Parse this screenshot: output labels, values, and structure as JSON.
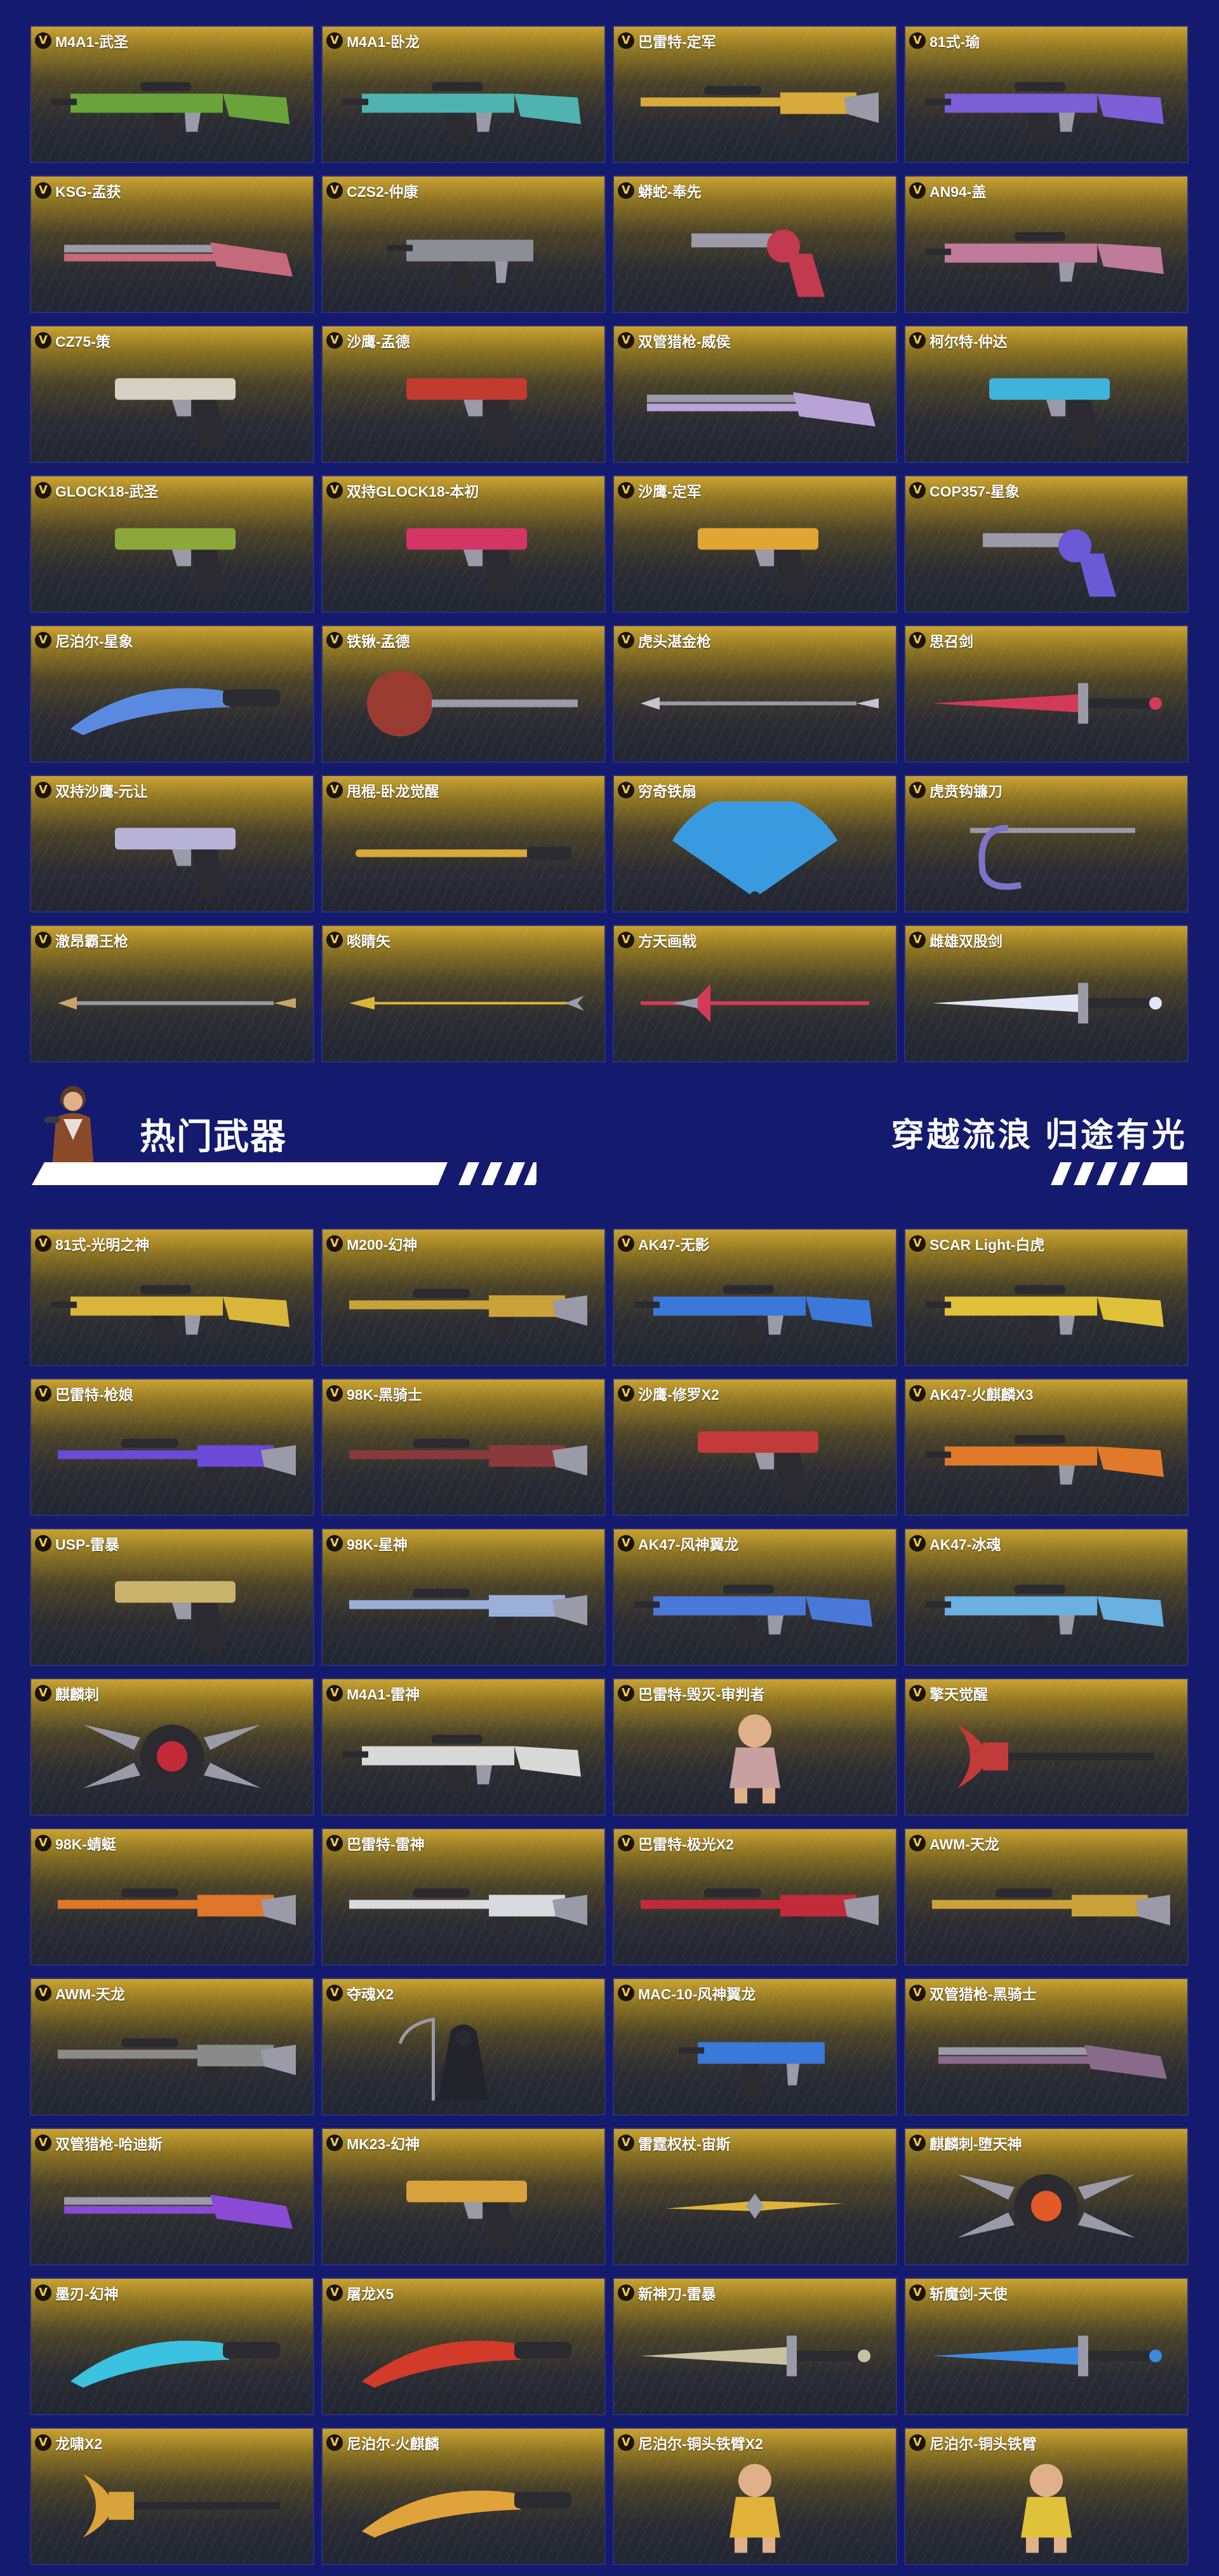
{
  "top_weapons": [
    {
      "name": "M4A1-武圣",
      "icon": "rifle-icon",
      "color": "#6aa33a"
    },
    {
      "name": "M4A1-卧龙",
      "icon": "rifle-icon",
      "color": "#4fb3b1"
    },
    {
      "name": "巴雷特-定军",
      "icon": "sniper-icon",
      "color": "#d8a93b"
    },
    {
      "name": "81式-瑜",
      "icon": "rifle-icon",
      "color": "#7c5fd6"
    },
    {
      "name": "KSG-孟获",
      "icon": "shotgun-icon",
      "color": "#c56a7a"
    },
    {
      "name": "CZS2-仲康",
      "icon": "smg-icon",
      "color": "#8b8e95"
    },
    {
      "name": "蟒蛇-奉先",
      "icon": "revolver-icon",
      "color": "#c23a4e"
    },
    {
      "name": "AN94-盖",
      "icon": "rifle-icon",
      "color": "#c07a9a"
    },
    {
      "name": "CZ75-策",
      "icon": "pistol-icon",
      "color": "#d9d0c4"
    },
    {
      "name": "沙鹰-孟德",
      "icon": "pistol-icon",
      "color": "#c13b2f"
    },
    {
      "name": "双管猎枪-威侯",
      "icon": "shotgun-icon",
      "color": "#b9a2d8"
    },
    {
      "name": "柯尔特-仲达",
      "icon": "pistol-icon",
      "color": "#3fb3d9"
    },
    {
      "name": "GLOCK18-武圣",
      "icon": "pistol-icon",
      "color": "#8da83a"
    },
    {
      "name": "双持GLOCK18-本初",
      "icon": "pistol-icon",
      "color": "#d23566"
    },
    {
      "name": "沙鹰-定军",
      "icon": "pistol-icon",
      "color": "#e0a634"
    },
    {
      "name": "COP357-星象",
      "icon": "revolver-icon",
      "color": "#6a5ad6"
    },
    {
      "name": "尼泊尔-星象",
      "icon": "knife-icon",
      "color": "#5a8ae0"
    },
    {
      "name": "铁锹-孟德",
      "icon": "shovel-icon",
      "color": "#9a3b32"
    },
    {
      "name": "虎头湛金枪",
      "icon": "spear-icon",
      "color": "#c9c2d2"
    },
    {
      "name": "思召剑",
      "icon": "sword-icon",
      "color": "#d23b58"
    },
    {
      "name": "双持沙鹰-元让",
      "icon": "pistol-icon",
      "color": "#b7b3d9"
    },
    {
      "name": "甩棍-卧龙觉醒",
      "icon": "baton-icon",
      "color": "#d9a83a"
    },
    {
      "name": "穷奇铁扇",
      "icon": "fan-icon",
      "color": "#3a9ae0"
    },
    {
      "name": "虎贲钩镰刀",
      "icon": "hook-icon",
      "color": "#7d74c9"
    },
    {
      "name": "澈昂霸王枪",
      "icon": "spear-icon",
      "color": "#c9a46a"
    },
    {
      "name": "啖睛矢",
      "icon": "arrow-icon",
      "color": "#d9b53a"
    },
    {
      "name": "方天画戟",
      "icon": "halberd-icon",
      "color": "#d23b58"
    },
    {
      "name": "雌雄双股剑",
      "icon": "sword-icon",
      "color": "#e0e6f5"
    }
  ],
  "banner": {
    "title": "热门武器",
    "slogan": "穿越流浪 归途有光",
    "stripe_color": "#ffffff"
  },
  "hot_weapons": [
    {
      "name": "81式-光明之神",
      "icon": "rifle-icon",
      "color": "#d9b53a"
    },
    {
      "name": "M200-幻神",
      "icon": "sniper-icon",
      "color": "#c9a23a"
    },
    {
      "name": "AK47-无影",
      "icon": "rifle-icon",
      "color": "#3a78d9"
    },
    {
      "name": "SCAR Light-白虎",
      "icon": "rifle-icon",
      "color": "#e0c23a"
    },
    {
      "name": "巴雷特-枪娘",
      "icon": "sniper-icon",
      "color": "#6a4ad6"
    },
    {
      "name": "98K-黑骑士",
      "icon": "sniper-icon",
      "color": "#8a3a3a"
    },
    {
      "name": "沙鹰-修罗X2",
      "icon": "pistol-icon",
      "color": "#c23a3a"
    },
    {
      "name": "AK47-火麒麟X3",
      "icon": "rifle-icon",
      "color": "#e07a2a"
    },
    {
      "name": "USP-雷暴",
      "icon": "pistol-icon",
      "color": "#c9b36a"
    },
    {
      "name": "98K-星神",
      "icon": "sniper-icon",
      "color": "#9ab0d9"
    },
    {
      "name": "AK47-风神翼龙",
      "icon": "rifle-icon",
      "color": "#4a78d9"
    },
    {
      "name": "AK47-冰魂",
      "icon": "rifle-icon",
      "color": "#6ab0e0"
    },
    {
      "name": "麒麟刺",
      "icon": "claw-icon",
      "color": "#c22a3a"
    },
    {
      "name": "M4A1-雷神",
      "icon": "rifle-icon",
      "color": "#d9d9d9"
    },
    {
      "name": "巴雷特-毁灭-审判者",
      "icon": "character-icon",
      "color": "#c9a0a0"
    },
    {
      "name": "擎天觉醒",
      "icon": "axe-icon",
      "color": "#c23a3a"
    },
    {
      "name": "98K-蜻蜓",
      "icon": "sniper-icon",
      "color": "#e0762a"
    },
    {
      "name": "巴雷特-雷神",
      "icon": "sniper-icon",
      "color": "#d9d9e0"
    },
    {
      "name": "巴雷特-极光X2",
      "icon": "sniper-icon",
      "color": "#c22a3a"
    },
    {
      "name": "AWM-天龙",
      "icon": "sniper-icon",
      "color": "#c9a23a"
    },
    {
      "name": "AWM-天龙",
      "icon": "sniper-icon",
      "color": "#8a8a8a"
    },
    {
      "name": "夺魂X2",
      "icon": "reaper-icon",
      "color": "#7a7a8a"
    },
    {
      "name": "MAC-10-风神翼龙",
      "icon": "smg-icon",
      "color": "#3a78d9"
    },
    {
      "name": "双管猎枪-黑骑士",
      "icon": "shotgun-icon",
      "color": "#8a6a8a"
    },
    {
      "name": "双管猎枪-哈迪斯",
      "icon": "shotgun-icon",
      "color": "#8a4ad6"
    },
    {
      "name": "MK23-幻神",
      "icon": "pistol-icon",
      "color": "#d9a23a"
    },
    {
      "name": "雷霆权杖-宙斯",
      "icon": "scepter-icon",
      "color": "#e0b23a"
    },
    {
      "name": "麒麟刺-堕天神",
      "icon": "claw-icon",
      "color": "#e05a2a"
    },
    {
      "name": "墨刃-幻神",
      "icon": "knife-icon",
      "color": "#3ac2e0"
    },
    {
      "name": "屠龙X5",
      "icon": "knife-icon",
      "color": "#d23a2a"
    },
    {
      "name": "新神刀-雷暴",
      "icon": "sword-icon",
      "color": "#c9c2a0"
    },
    {
      "name": "斩魔剑-天使",
      "icon": "sword-icon",
      "color": "#3a8ae0"
    },
    {
      "name": "龙啸X2",
      "icon": "axe-icon",
      "color": "#d9a23a"
    },
    {
      "name": "尼泊尔-火麒麟",
      "icon": "knife-icon",
      "color": "#e0a23a"
    },
    {
      "name": "尼泊尔-铜头铁臂X2",
      "icon": "character-icon",
      "color": "#e0b23a"
    },
    {
      "name": "尼泊尔-铜头铁臂",
      "icon": "character-icon",
      "color": "#e0c23a"
    }
  ]
}
